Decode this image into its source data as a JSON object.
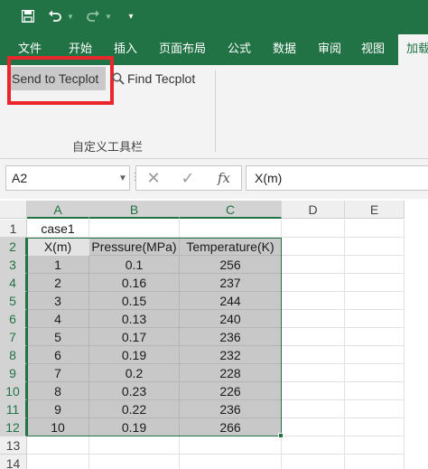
{
  "quick_access": {
    "save_icon": "save-icon",
    "undo_icon": "undo-icon",
    "redo_icon": "redo-icon",
    "customize_icon": "customize-toolbar-icon"
  },
  "ribbon_tabs": [
    "文件",
    "开始",
    "插入",
    "页面布局",
    "公式",
    "数据",
    "审阅",
    "视图",
    "加载"
  ],
  "ribbon": {
    "send_button": "Send to Tecplot",
    "find_button": "Find Tecplot",
    "find_icon": "magnifier-icon",
    "group_label": "自定义工具栏",
    "highlight_color": "#e8262c"
  },
  "formula_bar": {
    "name_box": "A2",
    "cancel_glyph": "✕",
    "enter_glyph": "✓",
    "function_glyph": "fx",
    "formula": "X(m)"
  },
  "grid": {
    "columns": [
      "A",
      "B",
      "C",
      "D",
      "E"
    ],
    "rows": [
      "1",
      "2",
      "3",
      "4",
      "5",
      "6",
      "7",
      "8",
      "9",
      "10",
      "11",
      "12",
      "13",
      "14"
    ],
    "sheet_title": "case1",
    "headers": [
      "X(m)",
      "Pressure(MPa)",
      "Temperature(K)"
    ],
    "data": [
      [
        "1",
        "0.1",
        "256"
      ],
      [
        "2",
        "0.16",
        "237"
      ],
      [
        "3",
        "0.15",
        "244"
      ],
      [
        "4",
        "0.13",
        "240"
      ],
      [
        "5",
        "0.17",
        "236"
      ],
      [
        "6",
        "0.19",
        "232"
      ],
      [
        "7",
        "0.2",
        "228"
      ],
      [
        "8",
        "0.23",
        "226"
      ],
      [
        "9",
        "0.22",
        "236"
      ],
      [
        "10",
        "0.19",
        "266"
      ]
    ]
  },
  "colors": {
    "accent": "#217346",
    "selection_fill": "#c8c8c8"
  }
}
